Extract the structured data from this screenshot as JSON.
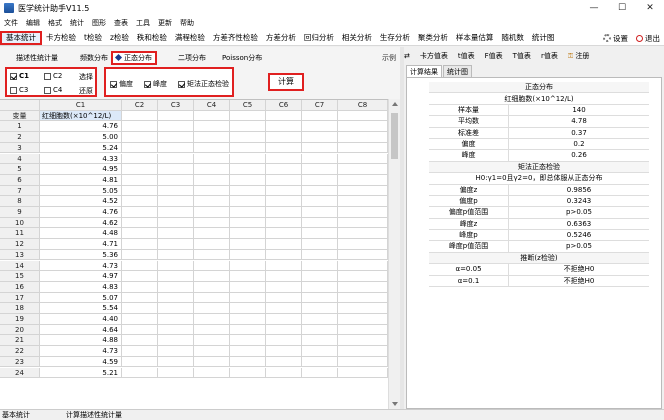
{
  "window": {
    "title": "医学统计助手V11.5",
    "controls": [
      "—",
      "☐",
      "✕"
    ]
  },
  "menu": [
    "文件",
    "编辑",
    "格式",
    "统计",
    "图形",
    "查表",
    "工具",
    "更新",
    "帮助"
  ],
  "toolbar": {
    "items": [
      "基本统计",
      "卡方检验",
      "t检验",
      "z检验",
      "秩和检验",
      "满程检验",
      "方差齐性检验",
      "方差分析",
      "回归分析",
      "相关分析",
      "生存分析",
      "聚类分析",
      "样本量估算",
      "随机数",
      "统计图"
    ],
    "active_index": 0,
    "settings_label": "设置",
    "exit_label": "退出"
  },
  "subtabs": {
    "items": [
      "描述性统计量",
      "频数分布",
      "正态分布",
      "二项分布",
      "Poisson分布"
    ],
    "selected_index": 2,
    "example_label": "示例"
  },
  "columns_panel": {
    "c1": "C1",
    "c2": "C2",
    "c3": "C3",
    "c4": "C4",
    "select_label": "选择",
    "restore_label": "还原",
    "c1_checked": true
  },
  "options_panel": {
    "skewness": "偏度",
    "kurtosis": "峰度",
    "moment_test": "矩法正态检验"
  },
  "calc_button": "计算",
  "grid": {
    "corner": "",
    "col_headers": [
      "C1",
      "C2",
      "C3",
      "C4",
      "C5",
      "C6",
      "C7",
      "C8"
    ],
    "var_row_label": "变量",
    "c1_label": "红细胞数(×10^12/L)",
    "rows": [
      {
        "n": "1",
        "v": "4.76"
      },
      {
        "n": "2",
        "v": "5.00"
      },
      {
        "n": "3",
        "v": "5.24"
      },
      {
        "n": "4",
        "v": "4.33"
      },
      {
        "n": "5",
        "v": "4.95"
      },
      {
        "n": "6",
        "v": "4.81"
      },
      {
        "n": "7",
        "v": "5.05"
      },
      {
        "n": "8",
        "v": "4.52"
      },
      {
        "n": "9",
        "v": "4.76"
      },
      {
        "n": "10",
        "v": "4.62"
      },
      {
        "n": "11",
        "v": "4.48"
      },
      {
        "n": "12",
        "v": "4.71"
      },
      {
        "n": "13",
        "v": "5.36"
      },
      {
        "n": "14",
        "v": "4.73"
      },
      {
        "n": "15",
        "v": "4.97"
      },
      {
        "n": "16",
        "v": "4.83"
      },
      {
        "n": "17",
        "v": "5.07"
      },
      {
        "n": "18",
        "v": "5.54"
      },
      {
        "n": "19",
        "v": "4.40"
      },
      {
        "n": "20",
        "v": "4.64"
      },
      {
        "n": "21",
        "v": "4.88"
      },
      {
        "n": "22",
        "v": "4.73"
      },
      {
        "n": "23",
        "v": "4.59"
      },
      {
        "n": "24",
        "v": "5.21"
      }
    ]
  },
  "right_toolbar": [
    "卡方值表",
    "t值表",
    "F值表",
    "T值表",
    "r值表",
    "注册"
  ],
  "result_tabs": [
    "计算结果",
    "统计图"
  ],
  "results": {
    "title": "正态分布",
    "subtitle": "红细胞数(×10^12/L)",
    "stats": [
      {
        "k": "样本量",
        "v": "140"
      },
      {
        "k": "平均数",
        "v": "4.78"
      },
      {
        "k": "标准差",
        "v": "0.37"
      },
      {
        "k": "偏度",
        "v": "0.2"
      },
      {
        "k": "峰度",
        "v": "0.26"
      }
    ],
    "moment_title": "矩法正态检验",
    "hypothesis": "H0:γ1=0且γ2=0，即总体服从正态分布",
    "moment": [
      {
        "k": "偏度z",
        "v": "0.9856"
      },
      {
        "k": "偏度p",
        "v": "0.3243"
      },
      {
        "k": "偏度p值范围",
        "v": "p>0.05"
      },
      {
        "k": "峰度z",
        "v": "0.6363"
      },
      {
        "k": "峰度p",
        "v": "0.5246"
      },
      {
        "k": "峰度p值范围",
        "v": "p>0.05"
      }
    ],
    "inference_title": "推断(z检验)",
    "inference": [
      {
        "k": "α=0.05",
        "v": "不拒绝H0"
      },
      {
        "k": "α=0.1",
        "v": "不拒绝H0"
      }
    ]
  },
  "status": {
    "left": "基本统计",
    "right": "计算描述性统计量"
  }
}
